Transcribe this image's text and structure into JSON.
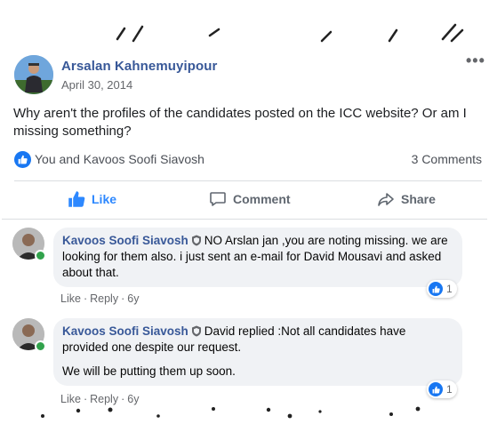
{
  "post": {
    "author": "Arsalan Kahnemuyipour",
    "date": "April 30, 2014",
    "more_label": "•••",
    "text": "Why aren't the profiles of the candidates posted on the ICC website? Or am I missing something?",
    "reactors": "You and Kavoos Soofi Siavosh",
    "comment_count": "3 Comments"
  },
  "actions": {
    "like": "Like",
    "comment": "Comment",
    "share": "Share"
  },
  "comments": [
    {
      "author": "Kavoos Soofi Siavosh",
      "text": "NO Arslan jan ,you are noting missing. we are looking for them also. i just sent an e-mail for David Mousavi and asked about that.",
      "reactions": "1",
      "like": "Like",
      "reply": "Reply",
      "time": "6y"
    },
    {
      "author": "Kavoos Soofi Siavosh",
      "text": "David replied :Not all candidates have provided one despite our request.",
      "text2": "We will be putting them up soon.",
      "reactions": "1",
      "like": "Like",
      "reply": "Reply",
      "time": "6y"
    }
  ],
  "icons": {
    "verified": "shield-icon",
    "like": "thumbs-up-icon",
    "comment": "speech-bubble-icon",
    "share": "share-arrow-icon"
  },
  "colors": {
    "accent": "#1877f2",
    "link": "#385898",
    "bubble": "#f0f2f5",
    "online": "#31a24c"
  }
}
